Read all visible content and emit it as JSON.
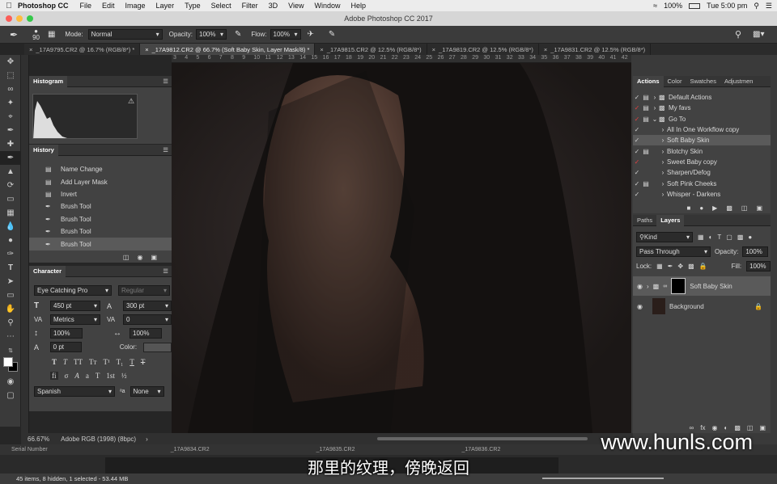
{
  "menubar": {
    "app_name": "Photoshop CC",
    "items": [
      "File",
      "Edit",
      "Image",
      "Layer",
      "Type",
      "Select",
      "Filter",
      "3D",
      "View",
      "Window",
      "Help"
    ],
    "window_title": "Adobe Photoshop CC 2017",
    "battery": "100%",
    "clock": "Tue 5:00 pm"
  },
  "options": {
    "brush_size": "90",
    "mode_label": "Mode:",
    "mode_value": "Normal",
    "opacity_label": "Opacity:",
    "opacity_value": "100%",
    "flow_label": "Flow:",
    "flow_value": "100%"
  },
  "tabs": [
    "_17A9795.CR2 @ 16.7% (RGB/8*) *",
    "_17A9812.CR2 @ 66.7% (Soft Baby Skin, Layer Mask/8) *",
    "_17A9815.CR2 @ 12.5% (RGB/8*)",
    "_17A9819.CR2 @ 12.5% (RGB/8*)",
    "_17A9831.CR2 @ 12.5% (RGB/8*)"
  ],
  "ruler": [
    "3",
    "4",
    "5",
    "6",
    "7",
    "8",
    "9",
    "10",
    "11",
    "12",
    "13",
    "14",
    "15",
    "16",
    "17",
    "18",
    "19",
    "20",
    "21",
    "22",
    "23",
    "24",
    "25",
    "26",
    "27",
    "28",
    "29",
    "30",
    "31",
    "32",
    "33",
    "34",
    "35",
    "36",
    "37",
    "38",
    "39",
    "40",
    "41",
    "42"
  ],
  "histogram": {
    "title": "Histogram"
  },
  "history": {
    "title": "History",
    "items": [
      "Name Change",
      "Add Layer Mask",
      "Invert",
      "Brush Tool",
      "Brush Tool",
      "Brush Tool",
      "Brush Tool"
    ]
  },
  "character": {
    "title": "Character",
    "font": "Eye Catching Pro",
    "style": "Regular",
    "size": "450 pt",
    "leading": "300 pt",
    "kerning": "Metrics",
    "tracking": "0",
    "vscale": "100%",
    "hscale": "100%",
    "baseline": "0 pt",
    "color_label": "Color:",
    "language": "Spanish",
    "aa_label": "a",
    "aa": "None"
  },
  "actions": {
    "tabs": [
      "Actions",
      "Color",
      "Swatches",
      "Adjustmen"
    ],
    "items": [
      {
        "label": "Default Actions",
        "type": "set"
      },
      {
        "label": "My favs",
        "type": "set"
      },
      {
        "label": "Go To",
        "type": "set-open"
      },
      {
        "label": "All In One Workflow copy",
        "type": "action"
      },
      {
        "label": "Soft Baby Skin",
        "type": "action-selected"
      },
      {
        "label": "Blotchy Skin",
        "type": "action"
      },
      {
        "label": "Sweet Baby copy",
        "type": "action"
      },
      {
        "label": "Sharpen/Defog",
        "type": "action"
      },
      {
        "label": "Soft Pink Cheeks",
        "type": "action"
      },
      {
        "label": "Whisper - Darkens",
        "type": "action"
      }
    ]
  },
  "layers": {
    "tabs": [
      "Paths",
      "Layers"
    ],
    "kind": "Kind",
    "blend": "Pass Through",
    "opacity_label": "Opacity:",
    "opacity": "100%",
    "lock_label": "Lock:",
    "fill_label": "Fill:",
    "fill": "100%",
    "items": [
      "Soft Baby Skin",
      "Background"
    ]
  },
  "status": {
    "zoom": "66.67%",
    "profile": "Adobe RGB (1998) (8bpc)"
  },
  "bridge": {
    "serial": "Serial Number",
    "status": "45 items, 8 hidden, 1 selected - 53.44 MB",
    "thumbs": [
      "_17A9834.CR2",
      "_17A9835.CR2",
      "_17A9836.CR2"
    ]
  },
  "subtitle": "那里的纹理，傍晚返回",
  "watermark": "www.hunls.com",
  "colors": {
    "accent": "#6f9fd8",
    "panel": "#424242",
    "panel_dark": "#353535"
  }
}
